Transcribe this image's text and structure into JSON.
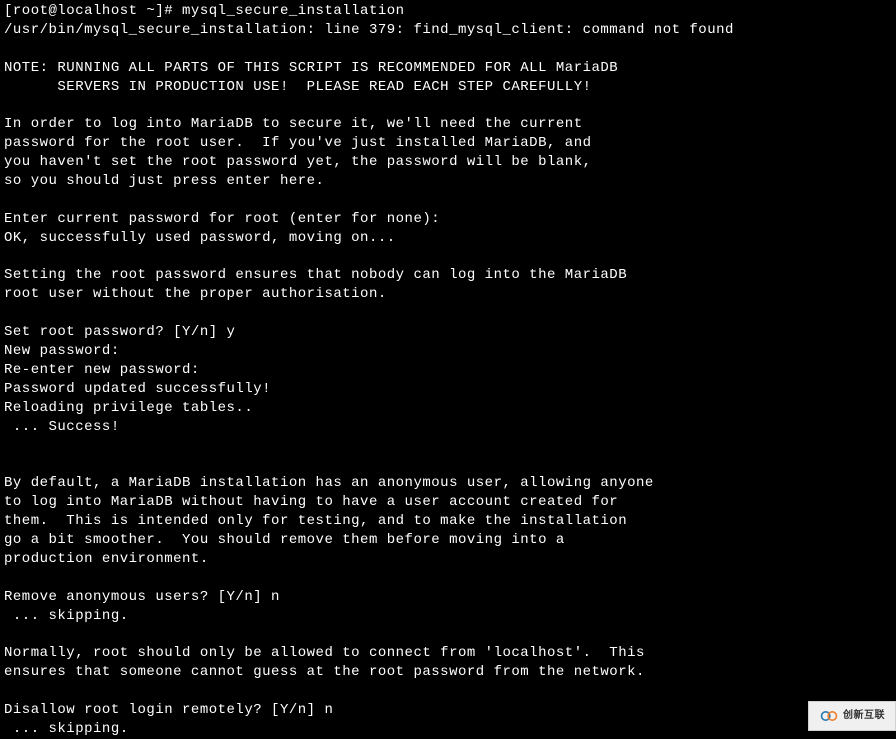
{
  "terminal": {
    "lines": [
      "[root@localhost ~]# mysql_secure_installation",
      "/usr/bin/mysql_secure_installation: line 379: find_mysql_client: command not found",
      "",
      "NOTE: RUNNING ALL PARTS OF THIS SCRIPT IS RECOMMENDED FOR ALL MariaDB",
      "      SERVERS IN PRODUCTION USE!  PLEASE READ EACH STEP CAREFULLY!",
      "",
      "In order to log into MariaDB to secure it, we'll need the current",
      "password for the root user.  If you've just installed MariaDB, and",
      "you haven't set the root password yet, the password will be blank,",
      "so you should just press enter here.",
      "",
      "Enter current password for root (enter for none):",
      "OK, successfully used password, moving on...",
      "",
      "Setting the root password ensures that nobody can log into the MariaDB",
      "root user without the proper authorisation.",
      "",
      "Set root password? [Y/n] y",
      "New password:",
      "Re-enter new password:",
      "Password updated successfully!",
      "Reloading privilege tables..",
      " ... Success!",
      "",
      "",
      "By default, a MariaDB installation has an anonymous user, allowing anyone",
      "to log into MariaDB without having to have a user account created for",
      "them.  This is intended only for testing, and to make the installation",
      "go a bit smoother.  You should remove them before moving into a",
      "production environment.",
      "",
      "Remove anonymous users? [Y/n] n",
      " ... skipping.",
      "",
      "Normally, root should only be allowed to connect from 'localhost'.  This",
      "ensures that someone cannot guess at the root password from the network.",
      "",
      "Disallow root login remotely? [Y/n] n",
      " ... skipping."
    ]
  },
  "watermark": {
    "text": "创新互联"
  }
}
